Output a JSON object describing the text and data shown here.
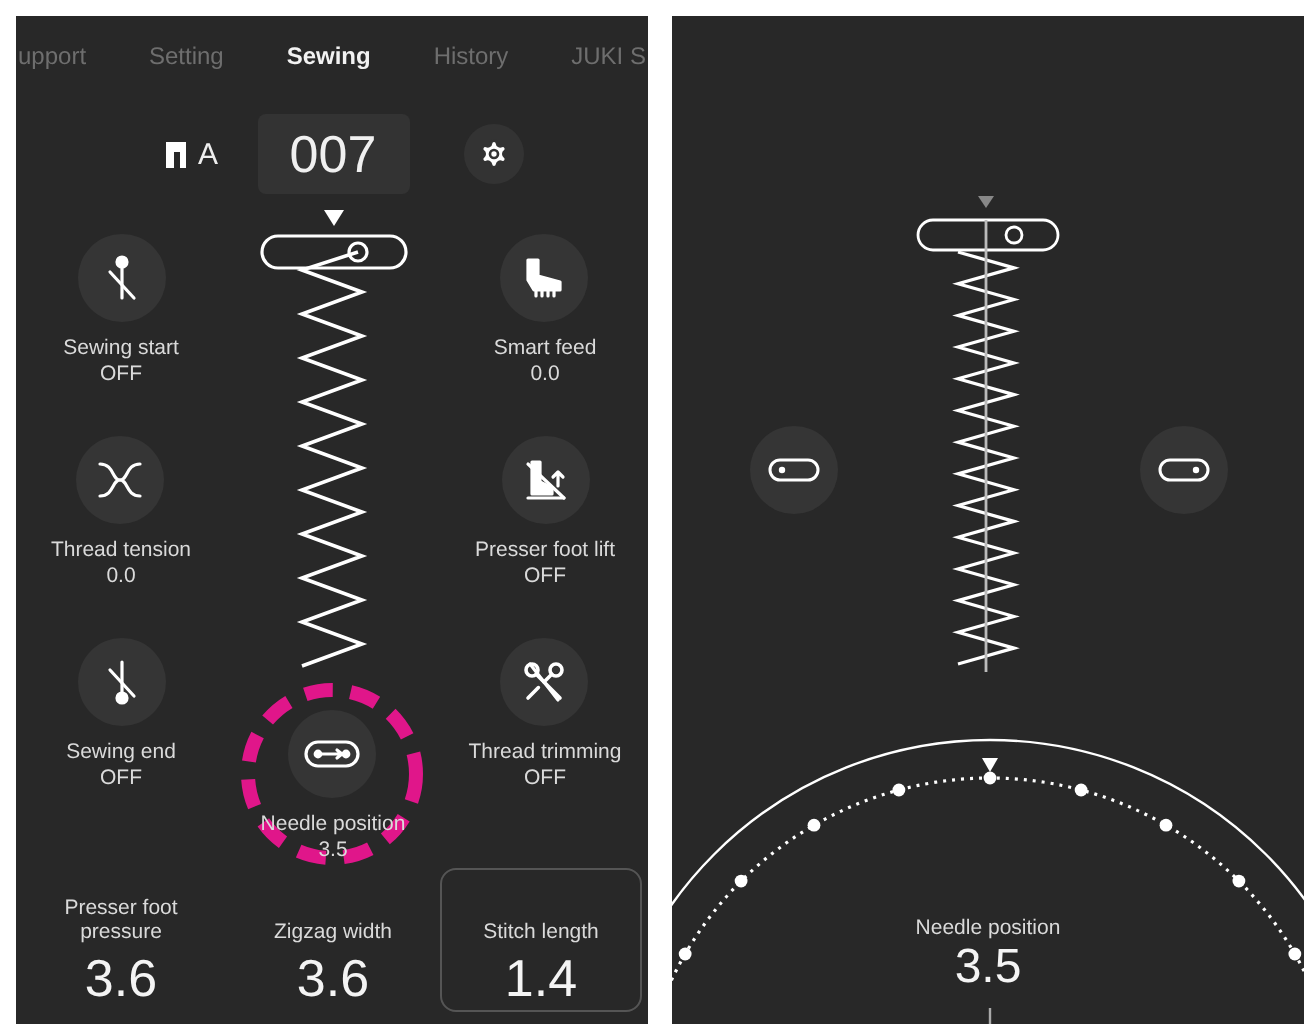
{
  "left_screen": {
    "tabs": [
      {
        "label": "upport",
        "selected": false
      },
      {
        "label": "Setting",
        "selected": false
      },
      {
        "label": "Sewing",
        "selected": true
      },
      {
        "label": "History",
        "selected": false
      },
      {
        "label": "JUKI S",
        "selected": false
      }
    ],
    "pattern": {
      "foot_label": "A",
      "number": "007"
    },
    "settings_left": [
      {
        "label": "Sewing start",
        "value": "OFF",
        "selected": false
      },
      {
        "label": "Thread tension",
        "value": "0.0",
        "selected": false
      },
      {
        "label": "Sewing end",
        "value": "OFF",
        "selected": false
      }
    ],
    "settings_right": [
      {
        "label": "Smart feed",
        "value": "0.0",
        "selected": false
      },
      {
        "label": "Presser foot lift",
        "value": "OFF",
        "selected": false
      },
      {
        "label": "Thread trimming",
        "value": "OFF",
        "selected": false
      }
    ],
    "settings_center": [
      {
        "label": "Needle position",
        "value": "3.5",
        "selected": true
      }
    ],
    "readouts": [
      {
        "label": "Presser foot pressure",
        "value": "3.6",
        "boxed": false
      },
      {
        "label": "Zigzag width",
        "value": "3.6",
        "boxed": false
      },
      {
        "label": "Stitch length",
        "value": "1.4",
        "boxed": true
      }
    ]
  },
  "right_screen": {
    "needle_position": {
      "label": "Needle position",
      "value": "3.5"
    }
  }
}
